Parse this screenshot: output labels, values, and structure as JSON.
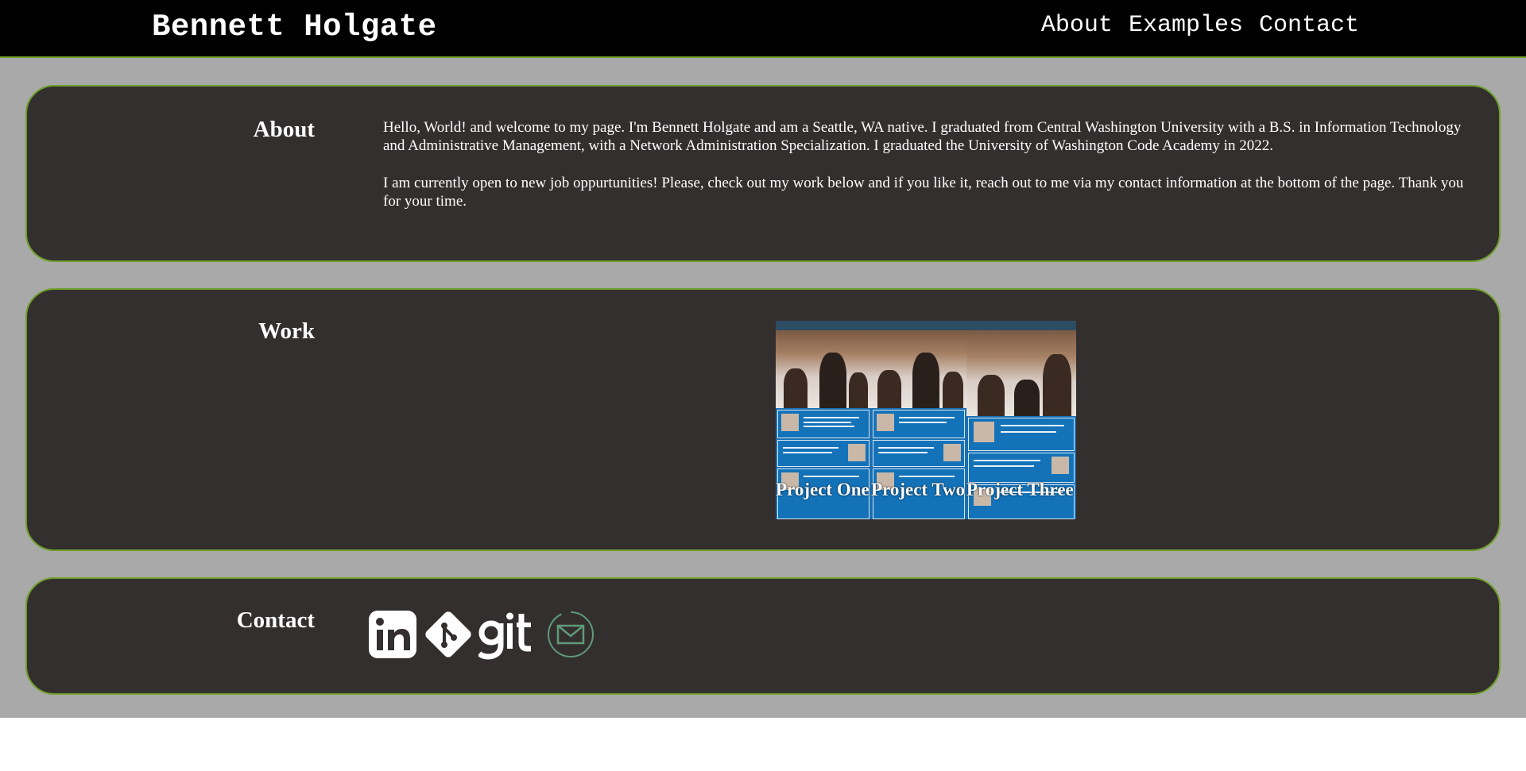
{
  "header": {
    "brand": "Bennett Holgate",
    "nav": [
      "About",
      "Examples",
      "Contact"
    ]
  },
  "about": {
    "heading": "About",
    "paragraphs": [
      "Hello, World! and welcome to my page. I'm Bennett Holgate and am a Seattle, WA native. I graduated from Central Washington University with a B.S. in Information Technology and Administrative Management, with a Network Administration Specialization. I graduated the University of Washington Code Academy in 2022.",
      "I am currently open to new job oppurtunities! Please, check out my work below and if you like it, reach out to me via my contact information at the bottom of the page. Thank you for your time."
    ]
  },
  "work": {
    "heading": "Work",
    "projects": [
      {
        "label": "Project One"
      },
      {
        "label": "Project Two"
      },
      {
        "label": "Project Three"
      }
    ]
  },
  "contact": {
    "heading": "Contact",
    "icons": [
      "linkedin-icon",
      "git-diamond-icon",
      "git-wordmark-icon",
      "email-icon"
    ]
  },
  "colors": {
    "header_bg": "#000000",
    "page_bg": "#a9a9a9",
    "card_bg": "#342f2f",
    "card_border": "#6fa02a",
    "text": "#ffffff"
  }
}
